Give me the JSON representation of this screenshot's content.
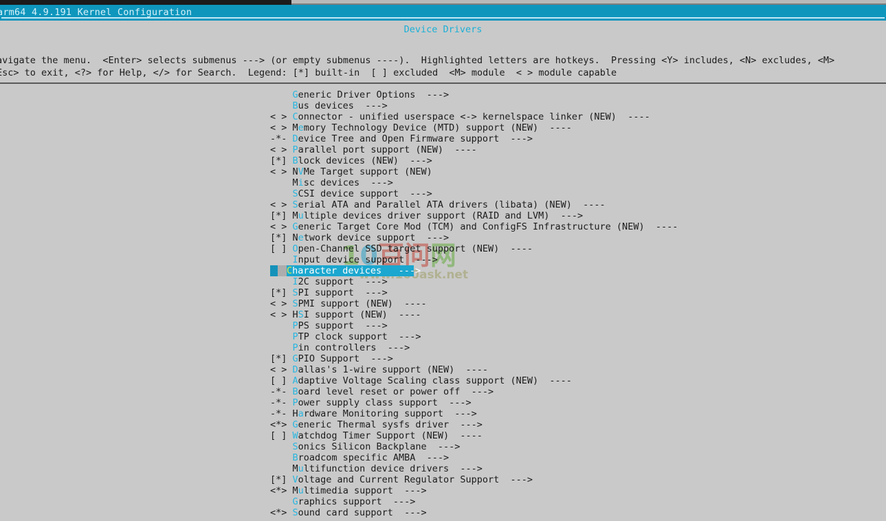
{
  "window": {
    "title": "arm64 4.9.191 Kernel Configuration"
  },
  "screen": {
    "menu_title": "Device Drivers",
    "help_line_1": "avigate the menu.  <Enter> selects submenus ---> (or empty submenus ----).  Highlighted letters are hotkeys.  Pressing <Y> includes, <N> excludes, <M>",
    "help_line_2": "Esc> to exit, <?> for Help, </> for Search.  Legend: [*] built-in  [ ] excluded  <M> module  < > module capable"
  },
  "watermark": {
    "logo_1": "1",
    "logo_0": "0",
    "logo_cn": "百问",
    "logo_net": "网",
    "url": "www.100ask.net"
  },
  "menu": {
    "items": [
      {
        "prefix": "    ",
        "pre": "",
        "hot": "G",
        "post": "eneric Driver Options",
        "arrow": "  --->"
      },
      {
        "prefix": "    ",
        "pre": "",
        "hot": "B",
        "post": "us devices",
        "arrow": "  --->"
      },
      {
        "prefix": "< > ",
        "pre": "",
        "hot": "C",
        "post": "onnector - unified userspace <-> kernelspace linker (NEW)",
        "arrow": "  ----"
      },
      {
        "prefix": "< > ",
        "pre": "M",
        "hot": "e",
        "post": "mory Technology Device (MTD) support (NEW)",
        "arrow": "  ----"
      },
      {
        "prefix": "-*- ",
        "pre": "",
        "hot": "D",
        "post": "evice Tree and Open Firmware support",
        "arrow": "  --->"
      },
      {
        "prefix": "< > ",
        "pre": "",
        "hot": "P",
        "post": "arallel port support (NEW)",
        "arrow": "  ----"
      },
      {
        "prefix": "[*] ",
        "pre": "",
        "hot": "B",
        "post": "lock devices (NEW)",
        "arrow": "  --->"
      },
      {
        "prefix": "< > ",
        "pre": "N",
        "hot": "V",
        "post": "Me Target support (NEW)",
        "arrow": ""
      },
      {
        "prefix": "    ",
        "pre": "M",
        "hot": "i",
        "post": "sc devices",
        "arrow": "  --->"
      },
      {
        "prefix": "    ",
        "pre": "",
        "hot": "S",
        "post": "CSI device support",
        "arrow": "  --->"
      },
      {
        "prefix": "< > ",
        "pre": "",
        "hot": "S",
        "post": "erial ATA and Parallel ATA drivers (libata) (NEW)",
        "arrow": "  ----"
      },
      {
        "prefix": "[*] ",
        "pre": "M",
        "hot": "u",
        "post": "ltiple devices driver support (RAID and LVM)",
        "arrow": "  --->"
      },
      {
        "prefix": "< > ",
        "pre": "",
        "hot": "G",
        "post": "eneric Target Core Mod (TCM) and ConfigFS Infrastructure (NEW)",
        "arrow": "  ----"
      },
      {
        "prefix": "[*] ",
        "pre": "N",
        "hot": "e",
        "post": "twork device support",
        "arrow": "  --->"
      },
      {
        "prefix": "[ ] ",
        "pre": "",
        "hot": "O",
        "post": "pen-Channel SSD target support (NEW)",
        "arrow": "  ----"
      },
      {
        "prefix": "    ",
        "pre": "",
        "hot": "I",
        "post": "nput device support",
        "arrow": "  --->"
      },
      {
        "prefix": "    ",
        "pre": "",
        "hot": "C",
        "post": "haracter devices",
        "arrow": "   --->",
        "selected": true
      },
      {
        "prefix": "    ",
        "pre": "",
        "hot": "I",
        "post": "2C support",
        "arrow": "  --->"
      },
      {
        "prefix": "[*] ",
        "pre": "",
        "hot": "S",
        "post": "PI support",
        "arrow": "  --->"
      },
      {
        "prefix": "< > ",
        "pre": "",
        "hot": "S",
        "post": "PMI support (NEW)",
        "arrow": "  ----"
      },
      {
        "prefix": "< > ",
        "pre": "H",
        "hot": "S",
        "post": "I support (NEW)",
        "arrow": "  ----"
      },
      {
        "prefix": "    ",
        "pre": "",
        "hot": "P",
        "post": "PS support",
        "arrow": "  --->"
      },
      {
        "prefix": "    ",
        "pre": "",
        "hot": "P",
        "post": "TP clock support",
        "arrow": "  --->"
      },
      {
        "prefix": "    ",
        "pre": "",
        "hot": "P",
        "post": "in controllers",
        "arrow": "  --->"
      },
      {
        "prefix": "[*] ",
        "pre": "",
        "hot": "G",
        "post": "PIO Support",
        "arrow": "  --->"
      },
      {
        "prefix": "< > ",
        "pre": "",
        "hot": "D",
        "post": "allas's 1-wire support (NEW)",
        "arrow": "  ----"
      },
      {
        "prefix": "[ ] ",
        "pre": "",
        "hot": "A",
        "post": "daptive Voltage Scaling class support (NEW)",
        "arrow": "  ----"
      },
      {
        "prefix": "-*- ",
        "pre": "",
        "hot": "B",
        "post": "oard level reset or power off",
        "arrow": "  --->"
      },
      {
        "prefix": "-*- ",
        "pre": "",
        "hot": "P",
        "post": "ower supply class support",
        "arrow": "  --->"
      },
      {
        "prefix": "-*- ",
        "pre": "H",
        "hot": "a",
        "post": "rdware Monitoring support",
        "arrow": "  --->"
      },
      {
        "prefix": "<*> ",
        "pre": "",
        "hot": "G",
        "post": "eneric Thermal sysfs driver",
        "arrow": "  --->"
      },
      {
        "prefix": "[ ] ",
        "pre": "",
        "hot": "W",
        "post": "atchdog Timer Support (NEW)",
        "arrow": "  ----"
      },
      {
        "prefix": "    ",
        "pre": "",
        "hot": "S",
        "post": "onics Silicon Backplane",
        "arrow": "  --->"
      },
      {
        "prefix": "    ",
        "pre": "",
        "hot": "B",
        "post": "roadcom specific AMBA",
        "arrow": "  --->"
      },
      {
        "prefix": "    ",
        "pre": "M",
        "hot": "u",
        "post": "ltifunction device drivers",
        "arrow": "  --->"
      },
      {
        "prefix": "[*] ",
        "pre": "",
        "hot": "V",
        "post": "oltage and Current Regulator Support",
        "arrow": "  --->"
      },
      {
        "prefix": "<*> ",
        "pre": "M",
        "hot": "u",
        "post": "ltimedia support",
        "arrow": "  --->"
      },
      {
        "prefix": "    ",
        "pre": "",
        "hot": "G",
        "post": "raphics support",
        "arrow": "  --->"
      },
      {
        "prefix": "<*> ",
        "pre": "",
        "hot": "S",
        "post": "ound card support",
        "arrow": "  --->"
      }
    ]
  }
}
